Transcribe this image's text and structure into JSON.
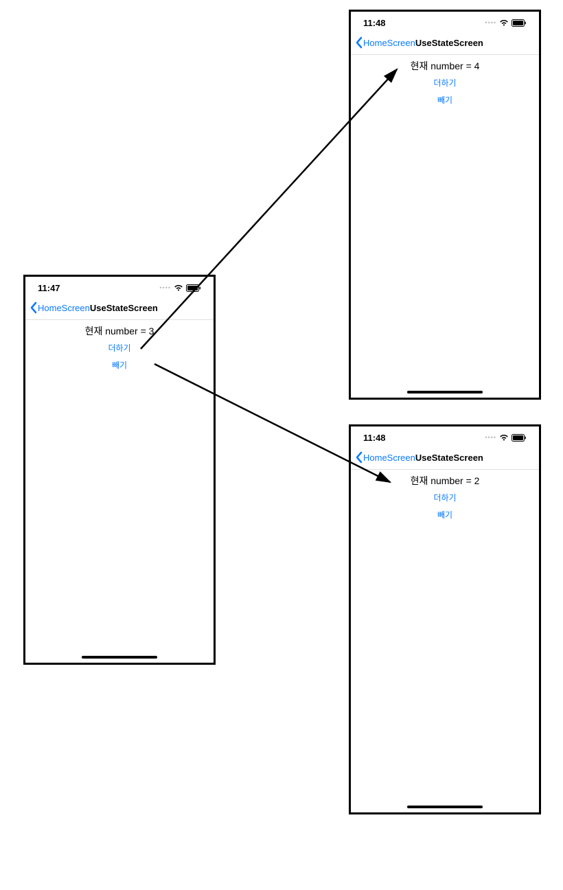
{
  "colors": {
    "ios_blue": "#0a7aff",
    "black": "#000000"
  },
  "screens": {
    "left": {
      "time": "11:47",
      "back_label": "HomeScreen",
      "title": "UseStateScreen",
      "number_text": "현재 number = 3",
      "add_label": "더하기",
      "sub_label": "빼기"
    },
    "top_right": {
      "time": "11:48",
      "back_label": "HomeScreen",
      "title": "UseStateScreen",
      "number_text": "현재 number = 4",
      "add_label": "더하기",
      "sub_label": "빼기"
    },
    "bottom_right": {
      "time": "11:48",
      "back_label": "HomeScreen",
      "title": "UseStateScreen",
      "number_text": "현재 number = 2",
      "add_label": "더하기",
      "sub_label": "빼기"
    }
  }
}
